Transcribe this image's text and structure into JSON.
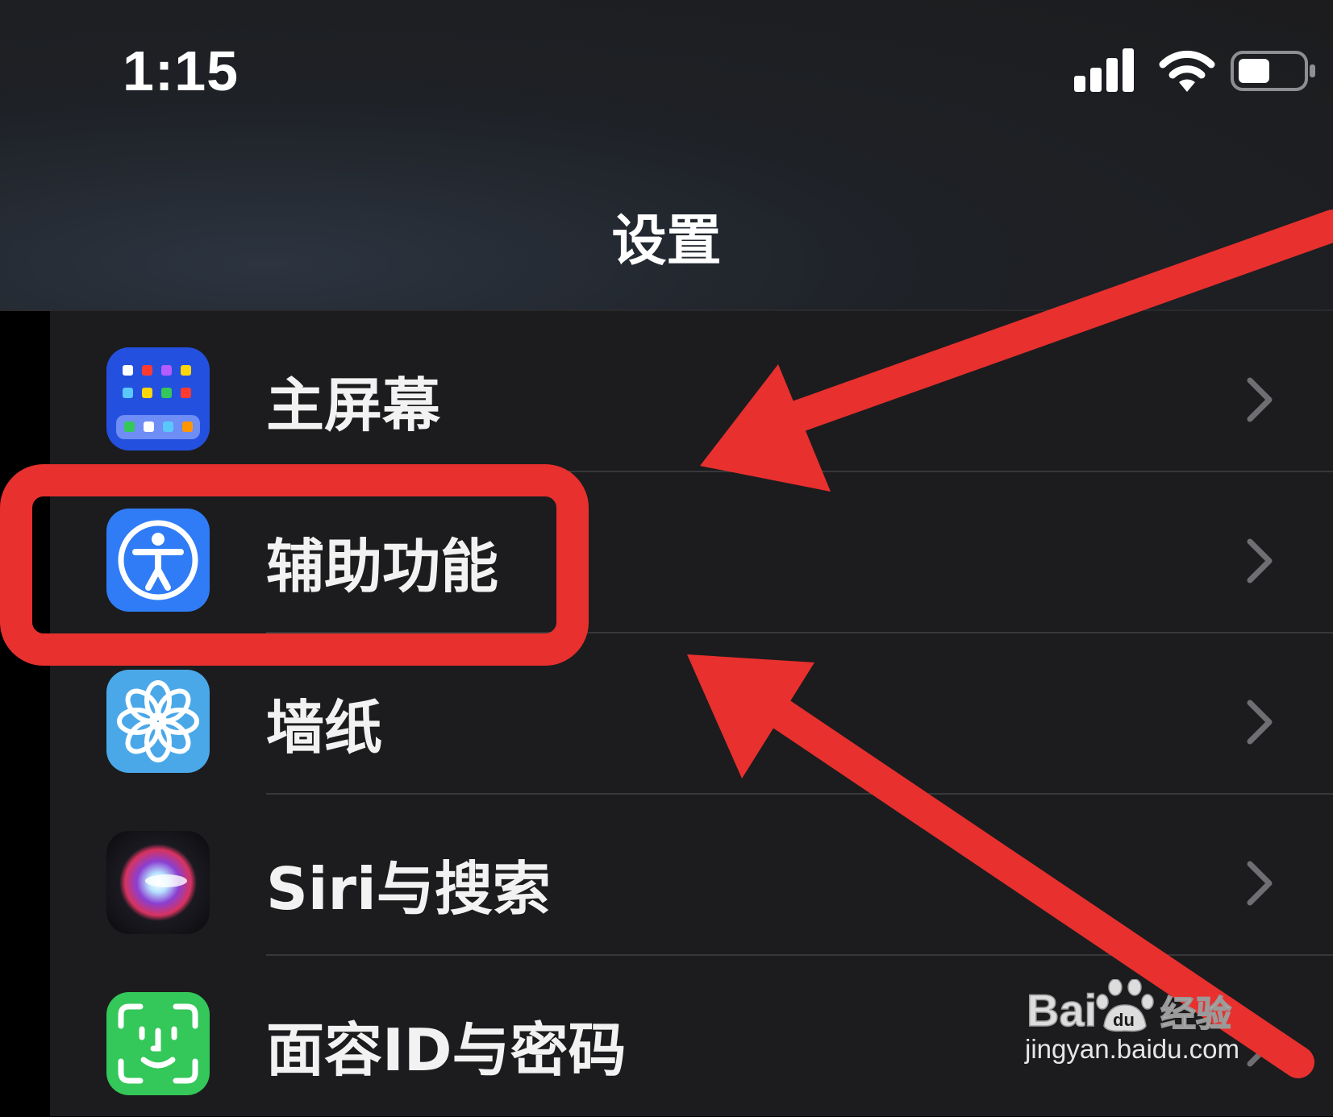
{
  "status_bar": {
    "time": "1:15",
    "icons": [
      "signal-icon",
      "wifi-icon",
      "battery-icon"
    ]
  },
  "nav": {
    "title": "设置"
  },
  "settings_rows": [
    {
      "label": "主屏幕",
      "icon": "home-screen-icon"
    },
    {
      "label": "辅助功能",
      "icon": "accessibility-icon"
    },
    {
      "label": "墙纸",
      "icon": "wallpaper-flower-icon"
    },
    {
      "label": "Siri与搜索",
      "icon": "siri-icon"
    },
    {
      "label": "面容ID与密码",
      "icon": "face-id-icon"
    }
  ],
  "annotations": {
    "highlight_color": "#e8302e"
  },
  "watermark": {
    "url": "jingyan.baidu.com"
  },
  "colors": {
    "background": "#1c1c1e",
    "text": "#f2f2f2",
    "chevron": "#6e6e73",
    "accessibility_blue": "#2f7cf6"
  }
}
